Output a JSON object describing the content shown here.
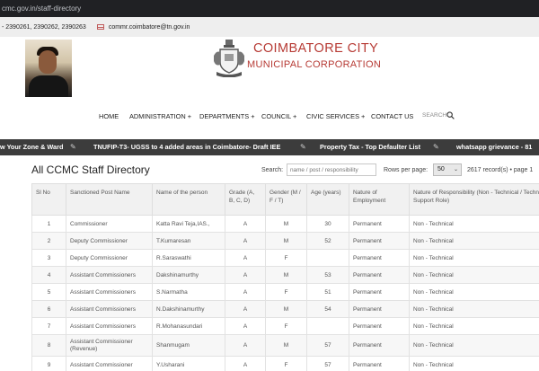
{
  "browser": {
    "url": "cmc.gov.in/staff-directory"
  },
  "contact": {
    "phone": "- 2390261, 2390262, 2390263",
    "email": "commr.coimbatore@tn.gov.in",
    "mail_icon": "mail-icon"
  },
  "brand": {
    "line1": "COIMBATORE CITY",
    "line2": "MUNICIPAL CORPORATION",
    "color": "#b73b35"
  },
  "nav": {
    "items": [
      "HOME",
      "ADMINISTRATION +",
      "DEPARTMENTS +",
      "COUNCIL +",
      "CIVIC SERVICES +",
      "CONTACT US"
    ],
    "search_label": "SEARCH",
    "search_icon": "search-icon"
  },
  "ticker": {
    "items": [
      "w Your Zone & Ward",
      "TNUFIP-T3- UGSS to 4 added areas in Coimbatore- Draft IEE",
      "Property Tax - Top Defaulter List",
      "whatsapp grievance - 81"
    ],
    "separator_icon": "paperclip-icon"
  },
  "directory": {
    "title": "All CCMC Staff Directory",
    "search_label": "Search:",
    "search_placeholder": "name / post / responsibility",
    "rows_label": "Rows per page:",
    "rows_value": "50",
    "records": "2617 record(s) • page 1"
  },
  "table": {
    "headers": [
      "Sl No",
      "Sanctioned Post Name",
      "Name of the person",
      "Grade (A, B, C, D)",
      "Gender (M / F / T)",
      "Age (years)",
      "Nature of Employment",
      "Nature of Responsibility (Non - Technical / Technical / Support Role)"
    ],
    "rows": [
      [
        "1",
        "Commissioner",
        "Katta Ravi Teja,IAS.,",
        "A",
        "M",
        "30",
        "Permanent",
        "Non - Technical"
      ],
      [
        "2",
        "Deputy Commissioner",
        "T.Kumaresan",
        "A",
        "M",
        "52",
        "Permanent",
        "Non - Technical"
      ],
      [
        "3",
        "Deputy Commissioner",
        "R.Saraswathi",
        "A",
        "F",
        "",
        "Permanent",
        "Non - Technical"
      ],
      [
        "4",
        "Assistant Commissioners",
        "Dakshinamurthy",
        "A",
        "M",
        "53",
        "Permanent",
        "Non - Technical"
      ],
      [
        "5",
        "Assistant Commissioners",
        "S.Narmatha",
        "A",
        "F",
        "51",
        "Permanent",
        "Non - Technical"
      ],
      [
        "6",
        "Assistant Commissioners",
        "N.Dakshinamurthy",
        "A",
        "M",
        "54",
        "Permanent",
        "Non - Technical"
      ],
      [
        "7",
        "Assistant Commissioners",
        "R.Mohanasundari",
        "A",
        "F",
        "",
        "Permanent",
        "Non - Technical"
      ],
      [
        "8",
        "Assistant Commissioner (Revenue)",
        "Shanmugam",
        "A",
        "M",
        "57",
        "Permanent",
        "Non - Technical"
      ],
      [
        "9",
        "Assistant Commissioner",
        "Y.Usharani",
        "A",
        "F",
        "57",
        "Permanent",
        "Non - Technical"
      ]
    ]
  }
}
